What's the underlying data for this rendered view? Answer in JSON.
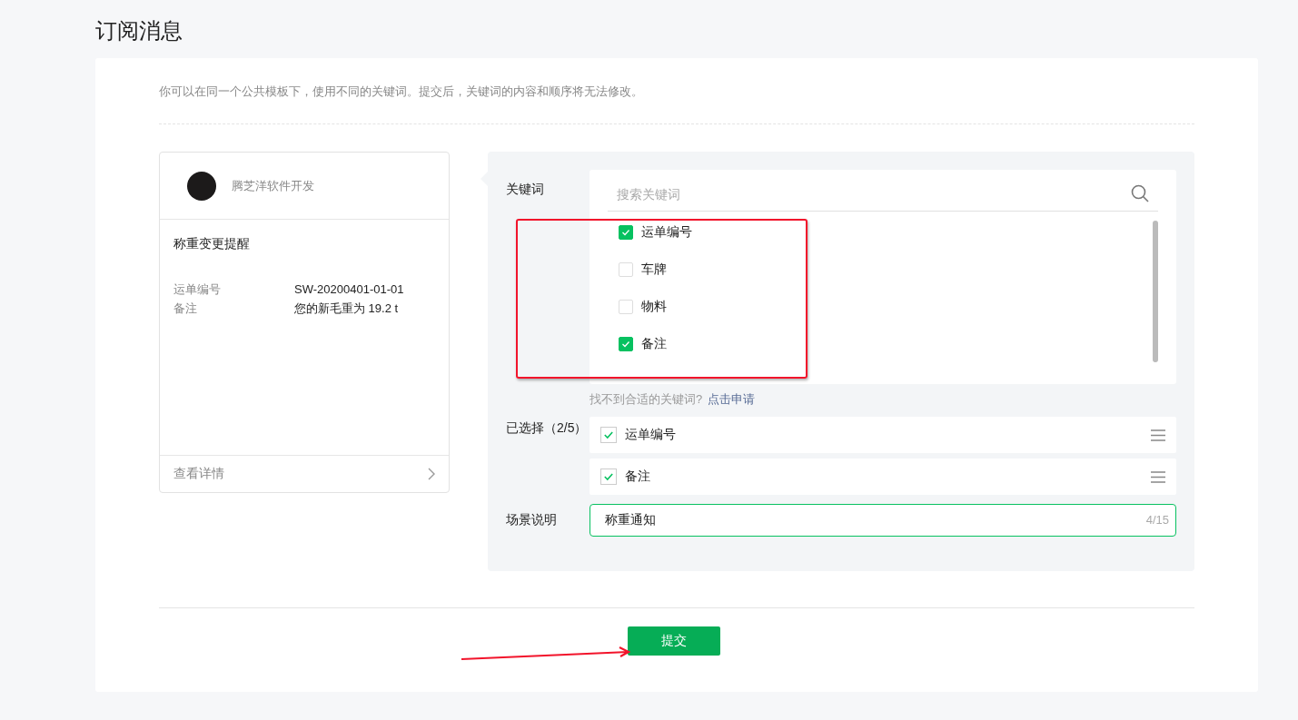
{
  "page_title": "订阅消息",
  "description": "你可以在同一个公共模板下，使用不同的关键词。提交后，关键词的内容和顺序将无法修改。",
  "preview": {
    "account_name": "腾芝洋软件开发",
    "template_title": "称重变更提醒",
    "fields": [
      {
        "label": "运单编号",
        "value": "SW-20200401-01-01"
      },
      {
        "label": "备注",
        "value": "您的新毛重为 19.2 t"
      }
    ],
    "details_link": "查看详情"
  },
  "keywords": {
    "label": "关键词",
    "search_placeholder": "搜索关键词",
    "options": [
      {
        "label": "运单编号",
        "checked": true
      },
      {
        "label": "车牌",
        "checked": false
      },
      {
        "label": "物料",
        "checked": false
      },
      {
        "label": "备注",
        "checked": true
      }
    ],
    "hint": "找不到合适的关键词?",
    "apply_link": "点击申请"
  },
  "selected": {
    "label": "已选择（2/5）",
    "items": [
      {
        "label": "运单编号",
        "checked": true
      },
      {
        "label": "备注",
        "checked": true
      }
    ]
  },
  "scene": {
    "label": "场景说明",
    "value": "称重通知",
    "counter": "4/15"
  },
  "submit": "提交"
}
